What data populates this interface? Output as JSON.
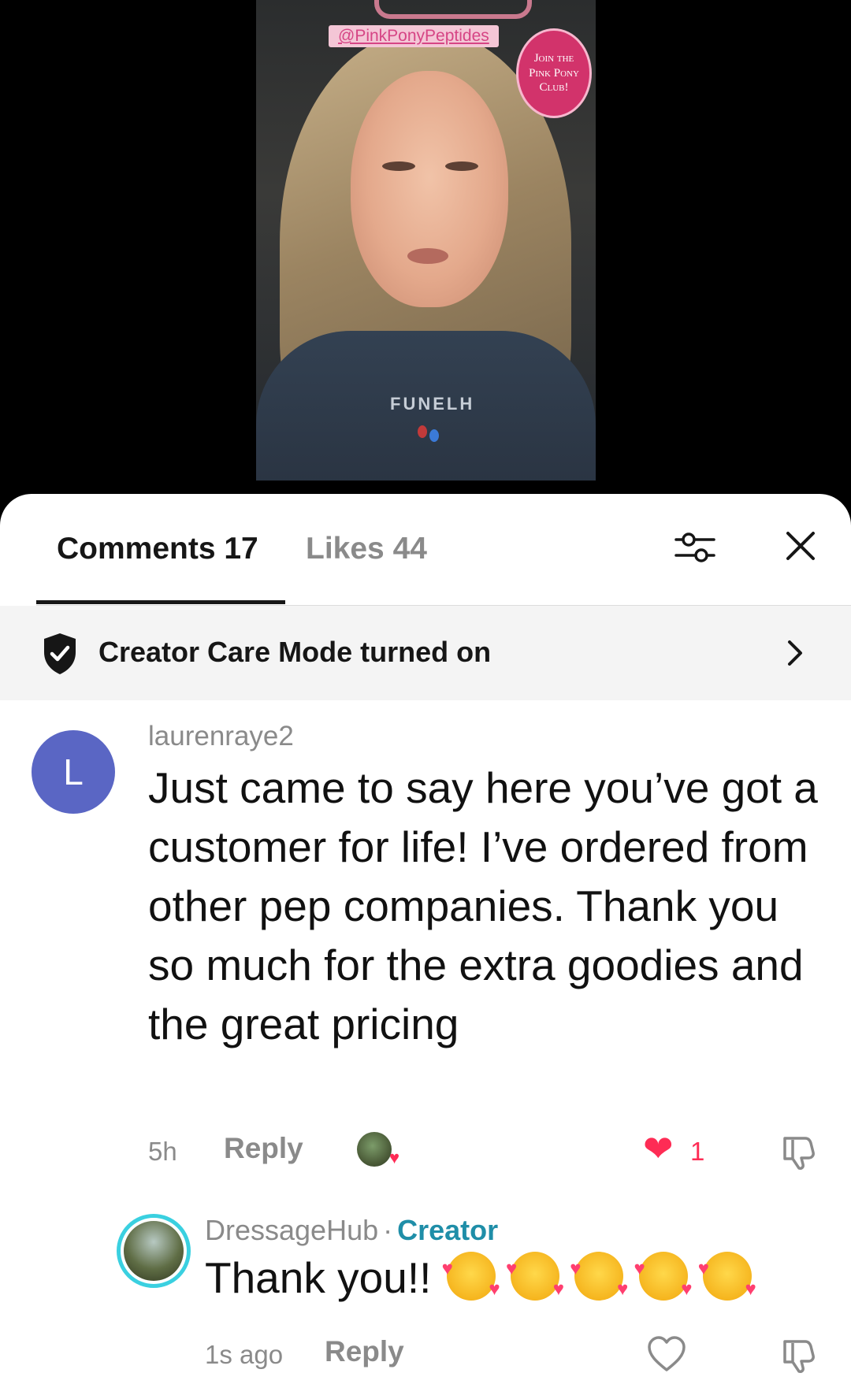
{
  "video": {
    "handle_tag": "@PinkPonyPeptides",
    "badge_lines": [
      "Join the",
      "Pink Pony",
      "Club!"
    ],
    "shirt_text": "FUNELH"
  },
  "tabs": {
    "comments_label": "Comments 17",
    "likes_label": "Likes 44"
  },
  "care_mode": {
    "label": "Creator Care Mode turned on"
  },
  "comments": [
    {
      "avatar_letter": "L",
      "username": "laurenraye2",
      "text": "Just came to say here you’ve got a customer for life! I’ve ordered from other pep companies. Thank you so much for the extra goodies and the great pricing",
      "time": "5h",
      "reply_label": "Reply",
      "like_count": "1"
    },
    {
      "username": "DressageHub",
      "separator": "·",
      "badge": "Creator",
      "text": "Thank you!!",
      "time": "1s ago",
      "reply_label": "Reply"
    }
  ],
  "colors": {
    "accent_red": "#fe2c55",
    "creator_teal": "#1f8ea8",
    "avatar_blue": "#5a66c4"
  },
  "icons": [
    "filter-icon",
    "close-icon",
    "shield-check-icon",
    "chevron-right-icon",
    "heart-filled-icon",
    "dislike-icon",
    "heart-outline-icon",
    "smiling-face-with-hearts-emoji"
  ]
}
